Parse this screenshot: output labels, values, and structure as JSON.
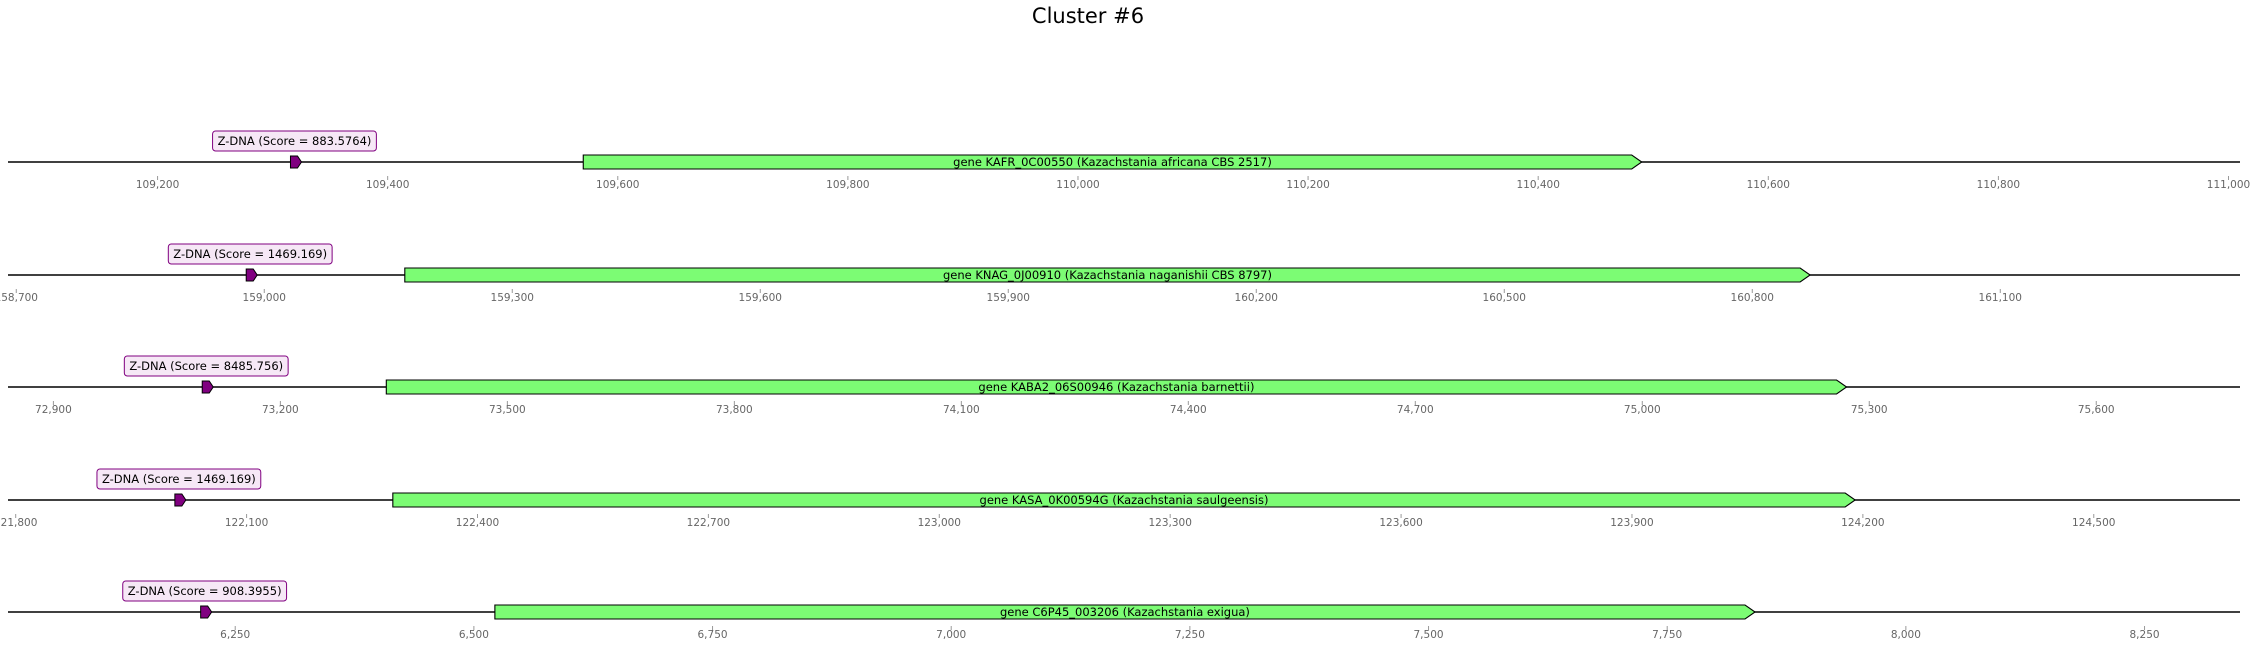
{
  "title": "Cluster #6",
  "colors": {
    "gene_fill": "#7cfc74",
    "zdna_fill": "#800080",
    "zdna_label_bg": "#f6e8f6",
    "zdna_label_border": "#800080",
    "track_line": "#000000",
    "tick_text": "#666666"
  },
  "icons": {
    "gene": "right-arrow-shape",
    "zdna": "pentagon-arrow-marker"
  },
  "chart_data": [
    {
      "type": "gene-track",
      "xlim": [
        109070,
        111010
      ],
      "ticks": [
        "109,200",
        "109,400",
        "109,600",
        "109,800",
        "110,000",
        "110,200",
        "110,400",
        "110,600",
        "110,800",
        "111,000"
      ],
      "tick_values": [
        109200,
        109400,
        109600,
        109800,
        110000,
        110200,
        110400,
        110600,
        110800,
        111000
      ],
      "gene": {
        "label": "gene KAFR_0C00550 (Kazachstania africana CBS 2517)",
        "start": 109570,
        "end": 110490
      },
      "zdna": {
        "label": "Z-DNA (Score = 883.5764)",
        "position": 109319
      }
    },
    {
      "type": "gene-track",
      "xlim": [
        158690,
        161390
      ],
      "ticks": [
        "158,700",
        "159,000",
        "159,300",
        "159,600",
        "159,900",
        "160,200",
        "160,500",
        "160,800",
        "161,100"
      ],
      "tick_values": [
        158700,
        159000,
        159300,
        159600,
        159900,
        160200,
        160500,
        160800,
        161100
      ],
      "gene": {
        "label": "gene KNAG_0J00910 (Kazachstania naganishii CBS 8797)",
        "start": 159170,
        "end": 160870
      },
      "zdna": {
        "label": "Z-DNA (Score = 1469.169)",
        "position": 158983
      }
    },
    {
      "type": "gene-track",
      "xlim": [
        72840,
        75790
      ],
      "ticks": [
        "72,900",
        "73,200",
        "73,500",
        "73,800",
        "74,100",
        "74,400",
        "74,700",
        "75,000",
        "75,300",
        "75,600"
      ],
      "tick_values": [
        72900,
        73200,
        73500,
        73800,
        74100,
        74400,
        74700,
        75000,
        75300,
        75600
      ],
      "gene": {
        "label": "gene KABA2_06S00946 (Kazachstania barnettii)",
        "start": 73340,
        "end": 75270
      },
      "zdna": {
        "label": "Z-DNA (Score = 8485.756)",
        "position": 73102
      }
    },
    {
      "type": "gene-track",
      "xlim": [
        121790,
        124690
      ],
      "ticks": [
        "121,800",
        "122,100",
        "122,400",
        "122,700",
        "123,000",
        "123,300",
        "123,600",
        "123,900",
        "124,200",
        "124,500"
      ],
      "tick_values": [
        121800,
        122100,
        122400,
        122700,
        123000,
        123300,
        123600,
        123900,
        124200,
        124500
      ],
      "gene": {
        "label": "gene KASA_0K00594G (Kazachstania saulgeensis)",
        "start": 122290,
        "end": 124190
      },
      "zdna": {
        "label": "Z-DNA (Score = 1469.169)",
        "position": 122012
      }
    },
    {
      "type": "gene-track",
      "xlim": [
        6012,
        8350
      ],
      "ticks": [
        "6,250",
        "6,500",
        "6,750",
        "7,000",
        "7,250",
        "7,500",
        "7,750",
        "8,000",
        "8,250"
      ],
      "tick_values": [
        6250,
        6500,
        6750,
        7000,
        7250,
        7500,
        7750,
        8000,
        8250
      ],
      "gene": {
        "label": "gene C6P45_003206 (Kazachstania exigua)",
        "start": 6522,
        "end": 7842
      },
      "zdna": {
        "label": "Z-DNA (Score = 908.3955)",
        "position": 6218
      }
    }
  ]
}
